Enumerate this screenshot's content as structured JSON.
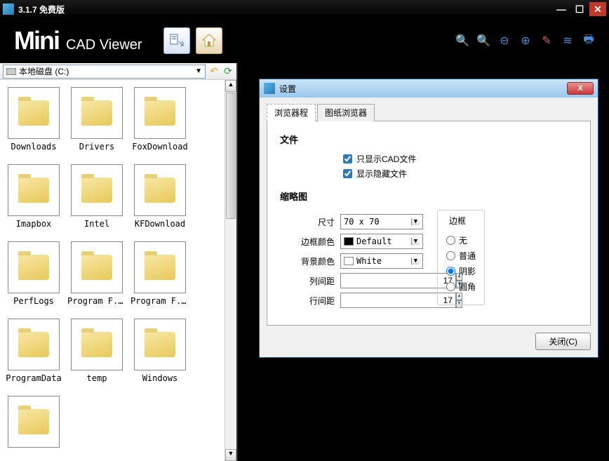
{
  "window": {
    "title": "3.1.7 免费版"
  },
  "app": {
    "logo_main": "Mini",
    "logo_sub": "CAD Viewer"
  },
  "drive": {
    "label": "本地磁盘 (C:)"
  },
  "folders": [
    "Downloads",
    "Drivers",
    "FoxDownload",
    "Imapbox",
    "Intel",
    "KFDownload",
    "PerfLogs",
    "Program F...",
    "Program F...",
    "ProgramData",
    "temp",
    "Windows",
    ""
  ],
  "dialog": {
    "title": "设置",
    "tabs": {
      "browser": "浏览器程",
      "drawing_browser": "图纸浏览器"
    },
    "file_section": "文件",
    "cb_cad_only": "只显示CAD文件",
    "cb_show_hidden": "显示隐藏文件",
    "thumb_section": "缩略图",
    "size_label": "尺寸",
    "size_value": "70 x 70",
    "border_color_label": "边框颜色",
    "border_color_value": "Default",
    "bg_color_label": "背景颜色",
    "bg_color_value": "White",
    "col_gap_label": "列间距",
    "col_gap_value": "17",
    "row_gap_label": "行间距",
    "row_gap_value": "17",
    "border_group": "边框",
    "border_none": "无",
    "border_normal": "普通",
    "border_shadow": "阴影",
    "border_round": "圆角",
    "close_btn": "关闭(C)"
  }
}
